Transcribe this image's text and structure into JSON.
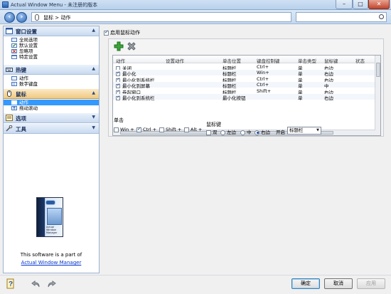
{
  "window": {
    "title": "Actual Window Menu - 未注册的版本"
  },
  "nav": {
    "breadcrumb": "鼠标 > 动作",
    "search_value": ""
  },
  "sidebar": {
    "sections": [
      {
        "title": "窗口设置",
        "items": [
          "全局选项",
          "默认设置",
          "忽略项",
          "特定设置"
        ]
      },
      {
        "title": "热键",
        "items": [
          "动作",
          "数字键盘"
        ]
      },
      {
        "title": "鼠标",
        "items": [
          "动作",
          "拖动滚动"
        ],
        "selected_item": "动作"
      },
      {
        "title": "选项",
        "items": []
      },
      {
        "title": "工具",
        "items": []
      }
    ],
    "promo": {
      "text": "This software is a part of",
      "link": "Actual Window Manager"
    }
  },
  "main": {
    "enable_label": "启用鼠标动作",
    "enable_checked": true,
    "table": {
      "columns": [
        "动作",
        "设置动作",
        "单击位置",
        "键盘控制键",
        "单击类型",
        "鼠标键",
        "状态"
      ],
      "rows": [
        {
          "checked": false,
          "action": "关闭",
          "position": "标题栏",
          "key": "Ctrl+",
          "type": "单",
          "button": "右边"
        },
        {
          "checked": true,
          "action": "最小化",
          "position": "标题栏",
          "key": "Win+",
          "type": "单",
          "button": "右边"
        },
        {
          "checked": true,
          "action": "最小化到系统栏",
          "position": "标题栏",
          "key": "Ctrl+",
          "type": "单",
          "button": "右边"
        },
        {
          "checked": true,
          "action": "最小化到屏幕",
          "position": "标题栏",
          "key": "Ctrl+",
          "type": "单",
          "button": "中"
        },
        {
          "checked": true,
          "action": "卷起窗口",
          "position": "标题栏",
          "key": "Shift+",
          "type": "单",
          "button": "右边"
        },
        {
          "checked": true,
          "action": "最小化到系统栏",
          "position": "最小化按钮",
          "key": "",
          "type": "单",
          "button": "右边"
        }
      ]
    },
    "click": {
      "label": "单击",
      "modifiers": [
        {
          "label": "Win +",
          "checked": false
        },
        {
          "label": "Ctrl +",
          "checked": true
        },
        {
          "label": "Shift +",
          "checked": false
        },
        {
          "label": "Alt +",
          "checked": false
        }
      ]
    },
    "mouse_button": {
      "label": "鼠标键",
      "double_label": "双",
      "double_checked": false,
      "options": [
        {
          "label": "左边",
          "selected": false
        },
        {
          "label": "中",
          "selected": false
        },
        {
          "label": "右边",
          "selected": true
        }
      ]
    },
    "open_label": "开启",
    "open_select_value": "标题栏"
  },
  "buttons": {
    "ok": "确定",
    "cancel": "取消",
    "apply": "应用"
  },
  "colors": {
    "selection": "#3399ff",
    "section_header": "#c9daf0",
    "selected_section": "#f0c981",
    "accent_link": "#0033cc"
  }
}
